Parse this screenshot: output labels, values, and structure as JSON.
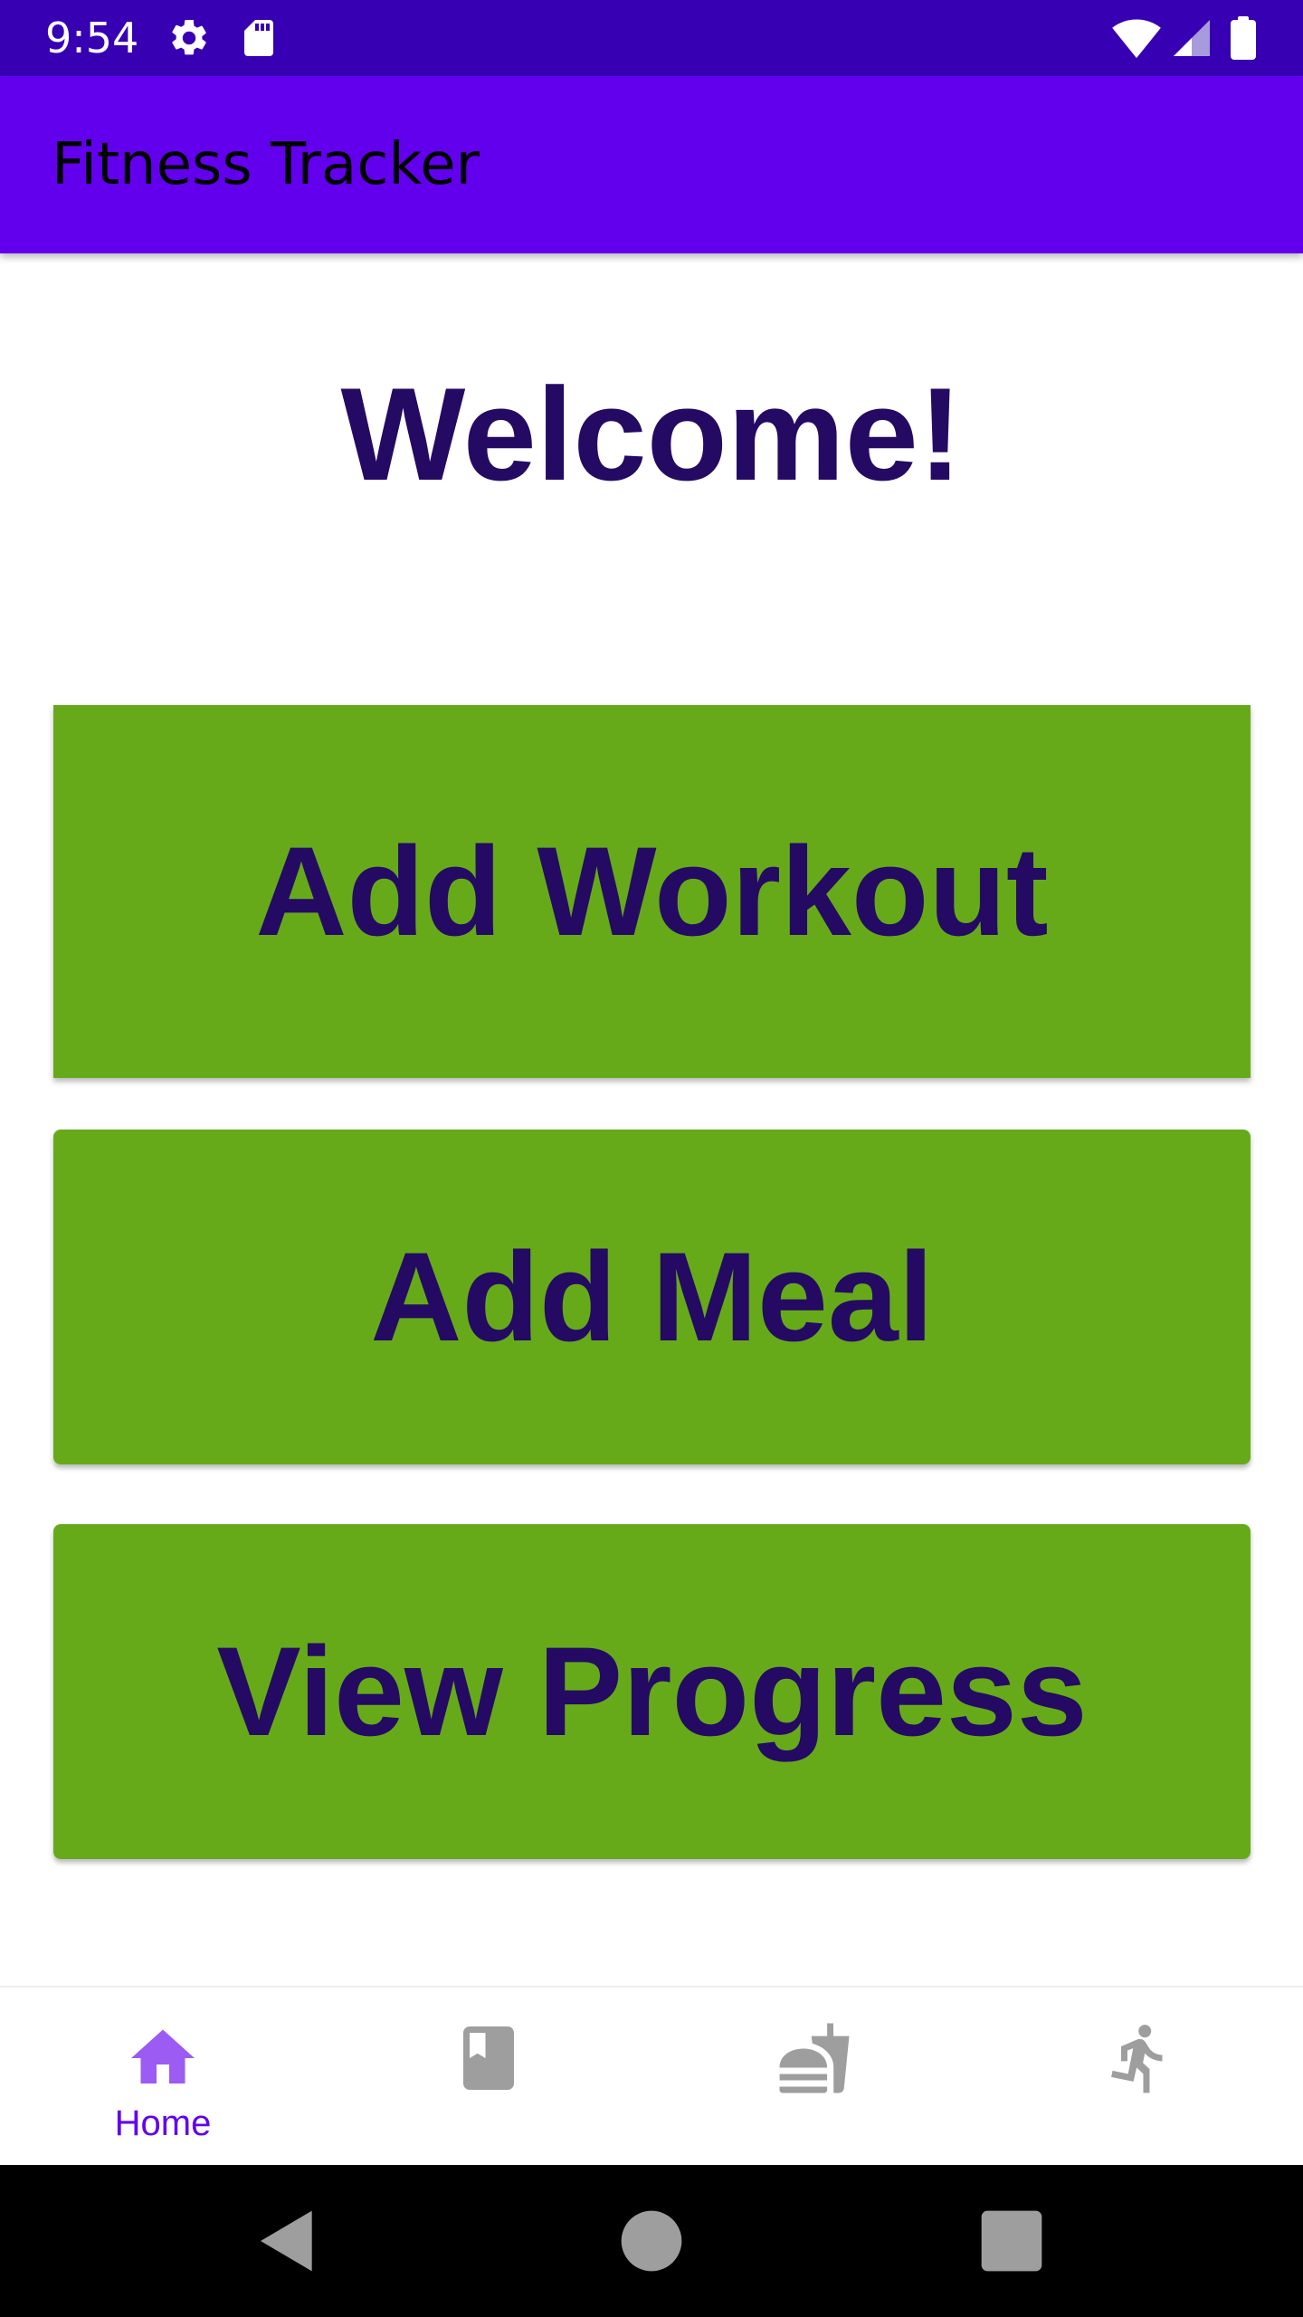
{
  "status_bar": {
    "time": "9:54",
    "icons_left": [
      "gear-icon",
      "sd-card-icon"
    ],
    "icons_right": [
      "wifi-icon",
      "signal-icon",
      "battery-icon"
    ]
  },
  "app_bar": {
    "title": "Fitness Tracker"
  },
  "main": {
    "welcome_text": "Welcome!",
    "buttons": [
      {
        "label": "Add Workout"
      },
      {
        "label": "Add Meal"
      },
      {
        "label": "View Progress"
      }
    ]
  },
  "bottom_nav": {
    "items": [
      {
        "label": "Home",
        "icon": "home-icon",
        "selected": true
      },
      {
        "label": "",
        "icon": "book-icon",
        "selected": false
      },
      {
        "label": "",
        "icon": "fastfood-icon",
        "selected": false
      },
      {
        "label": "",
        "icon": "running-icon",
        "selected": false
      }
    ]
  },
  "colors": {
    "status_bar": "#3700b3",
    "app_bar": "#6200ee",
    "button_green": "#66aa1a",
    "text_dark_purple": "#240a63",
    "nav_selected": "#6200ee",
    "nav_unselected": "#9e9e9e"
  }
}
